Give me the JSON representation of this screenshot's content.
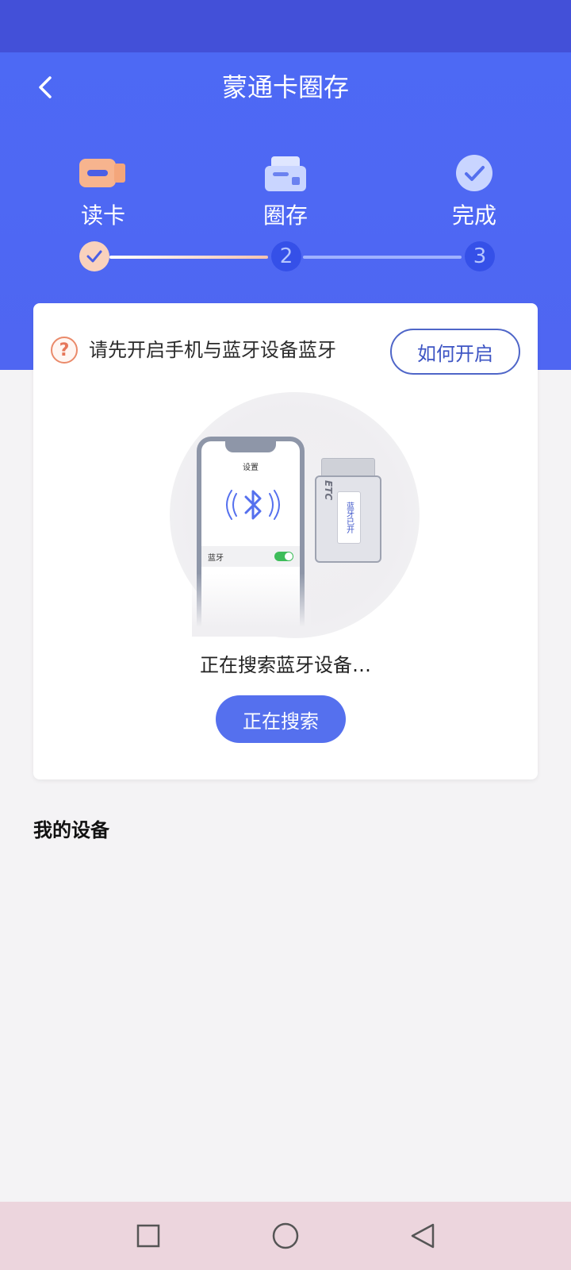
{
  "header": {
    "title": "蒙通卡圈存",
    "back_icon": "chevron-left-icon"
  },
  "steps": [
    {
      "label": "读卡",
      "number": "1",
      "state": "done",
      "icon": "card-reader-icon"
    },
    {
      "label": "圈存",
      "number": "2",
      "state": "pending",
      "icon": "card-slot-icon"
    },
    {
      "label": "完成",
      "number": "3",
      "state": "pending",
      "icon": "check-circle-icon"
    }
  ],
  "card": {
    "hint_text": "请先开启手机与蓝牙设备蓝牙",
    "how_button": "如何开启",
    "illustration": {
      "phone_settings_title": "设置",
      "phone_bt_label": "蓝牙",
      "device_brand": "ETC",
      "device_sticker": "蓝牙已开"
    },
    "status_text": "正在搜索蓝牙设备…",
    "search_button": "正在搜索"
  },
  "my_devices": {
    "title": "我的设备"
  },
  "colors": {
    "header_blue": "#4d69f4",
    "status_bar": "#4350d8",
    "accent_peach": "#f9d2bd",
    "button_blue": "#5570ee"
  }
}
